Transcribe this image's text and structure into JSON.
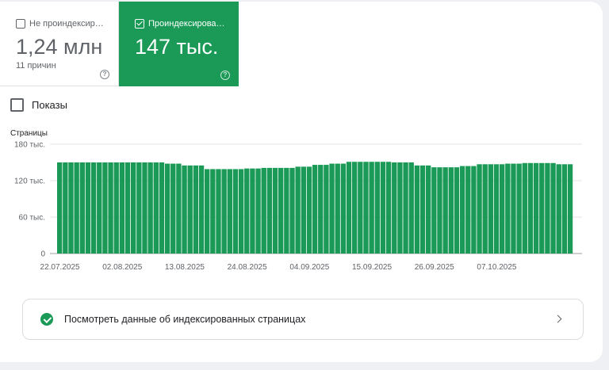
{
  "tiles": {
    "not_indexed": {
      "label": "Не проиндексир…",
      "value": "1,24 млн",
      "sub": "11 причин",
      "help": "?"
    },
    "indexed": {
      "label": "Проиндексирова…",
      "value": "147 тыс.",
      "help": "?"
    }
  },
  "shows_label": "Показы",
  "link": {
    "label": "Посмотреть данные об индексированных страницах"
  },
  "colors": {
    "accent": "#1a9a56",
    "grid": "#e6e6e6"
  },
  "chart_data": {
    "type": "bar",
    "ylabel": "Страницы",
    "ylim": [
      0,
      180000
    ],
    "yticks": [
      {
        "value": 0,
        "label": "0"
      },
      {
        "value": 60000,
        "label": "60 тыс."
      },
      {
        "value": 120000,
        "label": "120 тыс."
      },
      {
        "value": 180000,
        "label": "180 тыс."
      }
    ],
    "xtick_labels": [
      "22.07.2025",
      "02.08.2025",
      "13.08.2025",
      "24.08.2025",
      "04.09.2025",
      "15.09.2025",
      "26.09.2025",
      "07.10.2025"
    ],
    "xtick_every": 11,
    "values": [
      150000,
      150000,
      150000,
      150000,
      150000,
      150000,
      150000,
      150000,
      150000,
      150000,
      150000,
      150000,
      150000,
      150000,
      150000,
      150000,
      150000,
      150000,
      150000,
      148000,
      148000,
      148000,
      145000,
      145000,
      145000,
      145000,
      139000,
      139000,
      139000,
      139000,
      139000,
      139000,
      139000,
      140000,
      140000,
      140000,
      141000,
      141000,
      141000,
      141000,
      141000,
      141000,
      143000,
      143000,
      143000,
      146000,
      146000,
      146000,
      148000,
      148000,
      148000,
      151000,
      151000,
      151000,
      151000,
      151000,
      151000,
      151000,
      151000,
      150000,
      150000,
      150000,
      150000,
      145000,
      145000,
      145000,
      142000,
      142000,
      142000,
      142000,
      142000,
      144000,
      144000,
      144000,
      147000,
      147000,
      147000,
      147000,
      147000,
      148000,
      148000,
      148000,
      149000,
      149000,
      149000,
      149000,
      149000,
      149000,
      147000,
      147000,
      147000
    ]
  }
}
